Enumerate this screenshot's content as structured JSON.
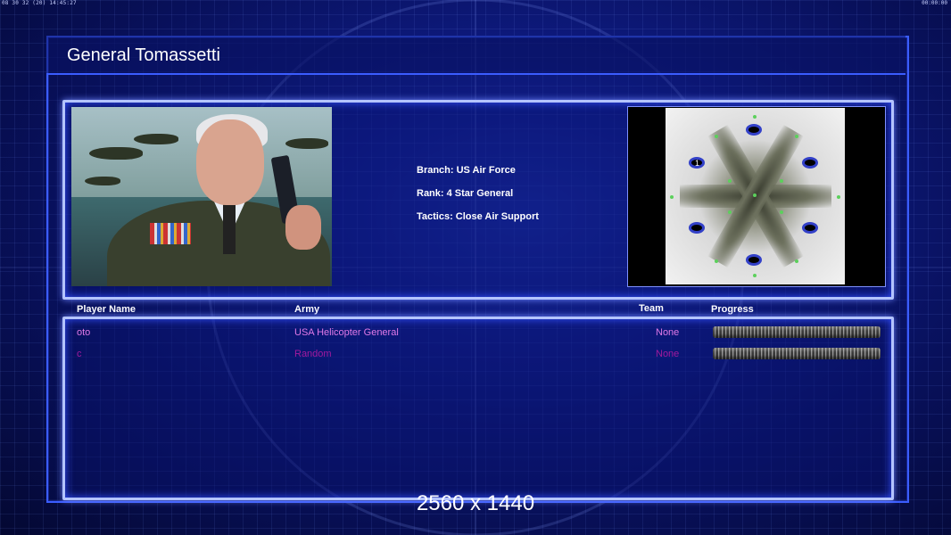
{
  "top_bar": {
    "left_text": "08 30 32 (20) 14:45:27",
    "right_text": "00:00:00"
  },
  "general": {
    "title": "General Tomassetti",
    "branch": "Branch: US Air Force",
    "rank": "Rank: 4 Star General",
    "tactics": "Tactics: Close Air Support"
  },
  "map": {
    "player_start_label": "1"
  },
  "players_table": {
    "headers": {
      "player_name": "Player Name",
      "army": "Army",
      "team": "Team",
      "progress": "Progress"
    },
    "rows": [
      {
        "name": "oto",
        "army": "USA Helicopter General",
        "team": "None",
        "progress_fraction": 1.0,
        "color": "#e079e8"
      },
      {
        "name": "c",
        "army": "Random",
        "team": "None",
        "progress_fraction": 1.0,
        "color": "#a31a9e"
      }
    ]
  },
  "resolution_label": "2560 x 1440"
}
